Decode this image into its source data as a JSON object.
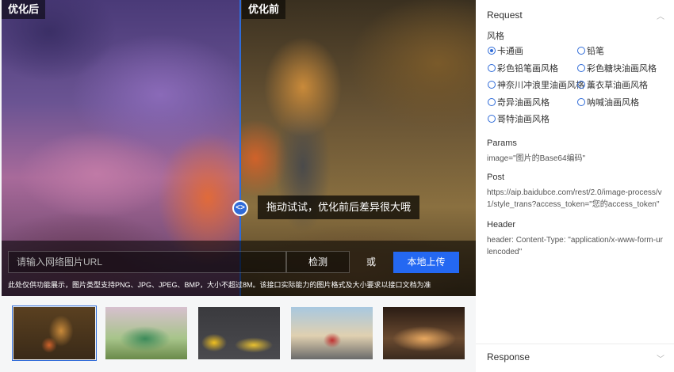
{
  "demo": {
    "label_after": "优化后",
    "label_before": "优化前",
    "drag_hint": "拖动试试，优化前后差异很大哦",
    "handle_glyph": "<>",
    "url_placeholder": "请输入网络图片URL",
    "detect_label": "检测",
    "or_label": "或",
    "upload_label": "本地上传",
    "notice": "此处仅供功能展示，图片类型支持PNG、JPG、JPEG、BMP，大小不超过8M。该接口实际能力的图片格式及大小要求以接口文档为准"
  },
  "thumbnails": [
    {
      "name": "girl-and-fox",
      "selected": true
    },
    {
      "name": "train-cherry-blossom",
      "selected": false
    },
    {
      "name": "living-room",
      "selected": false
    },
    {
      "name": "car-road",
      "selected": false
    },
    {
      "name": "restaurant-interior",
      "selected": false
    }
  ],
  "request": {
    "title": "Request",
    "style_label": "风格",
    "options": [
      {
        "label": "卡通画",
        "checked": true
      },
      {
        "label": "铅笔",
        "checked": false
      },
      {
        "label": "彩色铅笔画风格",
        "checked": false
      },
      {
        "label": "彩色糖块油画风格",
        "checked": false
      },
      {
        "label": "神奈川冲浪里油画风格",
        "checked": false
      },
      {
        "label": "薰衣草油画风格",
        "checked": false
      },
      {
        "label": "奇异油画风格",
        "checked": false
      },
      {
        "label": "呐喊油画风格",
        "checked": false
      },
      {
        "label": "哥特油画风格",
        "checked": false
      }
    ],
    "params_title": "Params",
    "params_body": "image=\"图片的Base64编码\"",
    "post_title": "Post",
    "post_body": "https://aip.baidubce.com/rest/2.0/image-process/v1/style_trans?access_token=\"您的access_token\"",
    "header_title": "Header",
    "header_body": "header: Content-Type: \"application/x-www-form-urlencoded\""
  },
  "response": {
    "title": "Response"
  },
  "colors": {
    "accent": "#2f6bd8",
    "upload_button": "#2468f2"
  },
  "icons": {
    "request_chevron": "chevron-up-icon",
    "response_chevron": "chevron-down-icon"
  }
}
